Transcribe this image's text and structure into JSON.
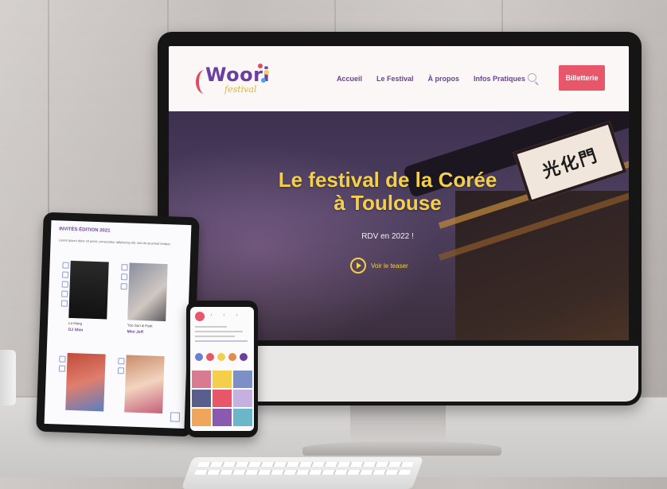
{
  "site": {
    "logo_text": "Woori",
    "logo_sub": "festival",
    "nav": [
      "Accueil",
      "Le Festival",
      "À propos",
      "Infos Pratiques"
    ],
    "ticket_button": "Billetterie",
    "hero_title_line1": "Le festival de la Corée",
    "hero_title_line2": "à Toulouse",
    "hero_subtitle": "RDV en 2022 !",
    "trailer_label": "Voir le teaser",
    "signboard_text": "光化門"
  },
  "tablet": {
    "title": "INVITÉS ÉDITION 2021",
    "intro": "Lorem ipsum dolor sit amet, consectetur adipiscing elit, sed do eiusmod tempor.",
    "cards": [
      {
        "label": "Lo Hang",
        "name": "DJ Shin"
      },
      {
        "label": "Yoo Sun & Park",
        "name": "Mini Jeff"
      }
    ]
  },
  "colors": {
    "brand_purple": "#6b3fa0",
    "brand_yellow": "#f3cf4c",
    "brand_red": "#e8566a"
  }
}
